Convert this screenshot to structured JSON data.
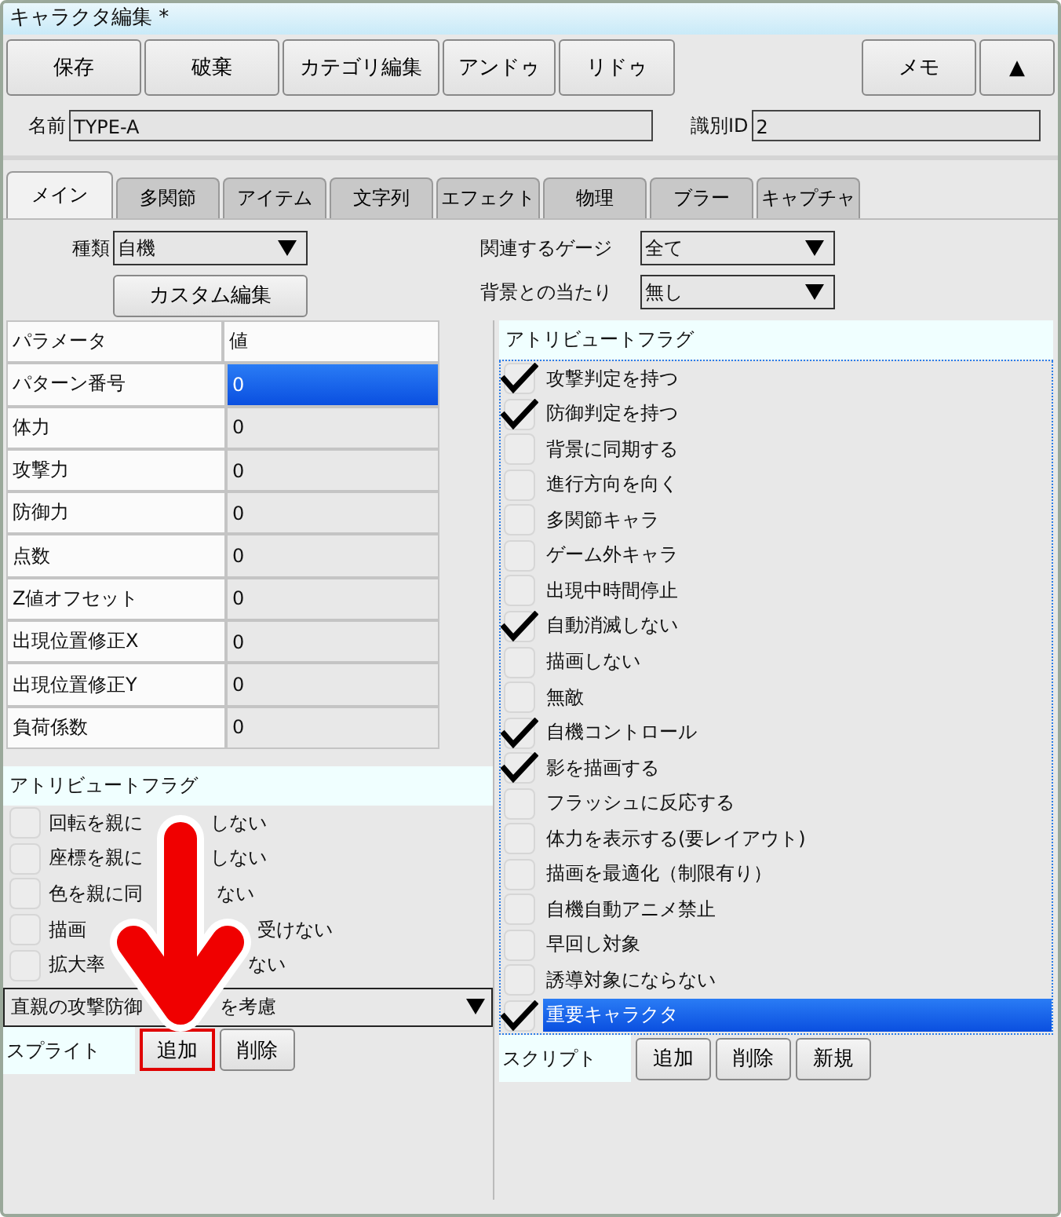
{
  "window": {
    "title": "キャラクタ編集 *"
  },
  "toolbar": {
    "buttons": [
      "保存",
      "破棄",
      "カテゴリ編集",
      "アンドゥ",
      "リドゥ"
    ],
    "right_buttons": [
      "メモ",
      "▲"
    ]
  },
  "name_field": {
    "label": "名前",
    "value": "TYPE-A"
  },
  "id_field": {
    "label": "識別ID",
    "value": "2"
  },
  "tabs": [
    {
      "label": "メイン",
      "selected": true
    },
    {
      "label": "多関節",
      "selected": false
    },
    {
      "label": "アイテム",
      "selected": false
    },
    {
      "label": "文字列",
      "selected": false
    },
    {
      "label": "エフェクト",
      "selected": false
    },
    {
      "label": "物理",
      "selected": false
    },
    {
      "label": "ブラー",
      "selected": false
    },
    {
      "label": "キャプチャ",
      "selected": false
    }
  ],
  "kind_select": {
    "label": "種類",
    "value": "自機"
  },
  "custom_edit_button": "カスタム編集",
  "gauge_select": {
    "label": "関連するゲージ",
    "value": "全て"
  },
  "background_hit_select": {
    "label": "背景との当たり",
    "value": "無し"
  },
  "parameters": {
    "columns": [
      "パラメータ",
      "値"
    ],
    "rows": [
      {
        "name": "パターン番号",
        "value": "0",
        "selected": true
      },
      {
        "name": "体力",
        "value": "0",
        "selected": false
      },
      {
        "name": "攻撃力",
        "value": "0",
        "selected": false
      },
      {
        "name": "防御力",
        "value": "0",
        "selected": false
      },
      {
        "name": "点数",
        "value": "0",
        "selected": false
      },
      {
        "name": "Z値オフセット",
        "value": "0",
        "selected": false
      },
      {
        "name": "出現位置修正X",
        "value": "0",
        "selected": false
      },
      {
        "name": "出現位置修正Y",
        "value": "0",
        "selected": false
      },
      {
        "name": "負荷係数",
        "value": "0",
        "selected": false
      }
    ]
  },
  "sprite_flags": {
    "title": "アトリビュートフラグ",
    "items": [
      {
        "parts": [
          "回転を親に",
          "しない"
        ],
        "checked": false
      },
      {
        "parts": [
          "座標を親に",
          "しない"
        ],
        "checked": false
      },
      {
        "parts": [
          "色を親に同",
          "ない"
        ],
        "checked": false
      },
      {
        "parts": [
          "描画",
          "受けない"
        ],
        "checked": false
      },
      {
        "parts": [
          "拡大率",
          "ない"
        ],
        "checked": false
      }
    ]
  },
  "sprite_dropdown": {
    "parts": [
      "直親の攻撃防御",
      "を考慮"
    ]
  },
  "sprite": {
    "label": "スプライト",
    "buttons": [
      {
        "label": "追加",
        "highlighted": true
      },
      {
        "label": "削除",
        "highlighted": false
      }
    ]
  },
  "attribute_flags": {
    "title": "アトリビュートフラグ",
    "items": [
      {
        "label": "攻撃判定を持つ",
        "checked": true,
        "selected": false
      },
      {
        "label": "防御判定を持つ",
        "checked": true,
        "selected": false
      },
      {
        "label": "背景に同期する",
        "checked": false,
        "selected": false
      },
      {
        "label": "進行方向を向く",
        "checked": false,
        "selected": false
      },
      {
        "label": "多関節キャラ",
        "checked": false,
        "selected": false
      },
      {
        "label": "ゲーム外キャラ",
        "checked": false,
        "selected": false
      },
      {
        "label": "出現中時間停止",
        "checked": false,
        "selected": false
      },
      {
        "label": "自動消滅しない",
        "checked": true,
        "selected": false
      },
      {
        "label": "描画しない",
        "checked": false,
        "selected": false
      },
      {
        "label": "無敵",
        "checked": false,
        "selected": false
      },
      {
        "label": "自機コントロール",
        "checked": true,
        "selected": false
      },
      {
        "label": "影を描画する",
        "checked": true,
        "selected": false
      },
      {
        "label": "フラッシュに反応する",
        "checked": false,
        "selected": false
      },
      {
        "label": "体力を表示する(要レイアウト)",
        "checked": false,
        "selected": false
      },
      {
        "label": "描画を最適化（制限有り）",
        "checked": false,
        "selected": false
      },
      {
        "label": "自機自動アニメ禁止",
        "checked": false,
        "selected": false
      },
      {
        "label": "早回し対象",
        "checked": false,
        "selected": false
      },
      {
        "label": "誘導対象にならない",
        "checked": false,
        "selected": false
      },
      {
        "label": "重要キャラクタ",
        "checked": true,
        "selected": true
      }
    ]
  },
  "script": {
    "label": "スクリプト",
    "buttons": [
      "追加",
      "削除",
      "新規"
    ]
  }
}
